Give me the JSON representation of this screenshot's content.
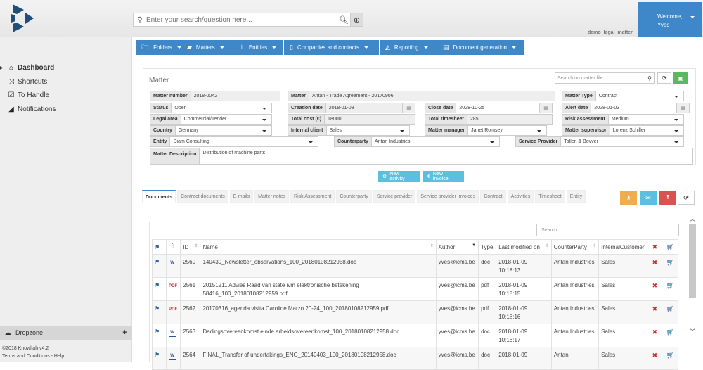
{
  "header": {
    "search_placeholder": "Enter your search/question here...",
    "welcome": "Welcome,",
    "user": "Yves",
    "workspace": "demo_legal_matter"
  },
  "sidebar": {
    "items": [
      {
        "label": "Dashboard",
        "icon": "home-icon",
        "active": true
      },
      {
        "label": "Shortcuts",
        "icon": "shuffle-icon"
      },
      {
        "label": "To Handle",
        "icon": "checkbox-icon"
      },
      {
        "label": "Notifications",
        "icon": "rss-icon"
      }
    ],
    "dropzone": "Dropzone",
    "copyright": "©2018 Knowliah v4.2",
    "terms": "Terms and Conditions - Help"
  },
  "menu": [
    {
      "label": "Folders",
      "icon": "folder-open-icon"
    },
    {
      "label": "Matters",
      "icon": "book-icon"
    },
    {
      "label": "Entities",
      "icon": "sitemap-icon"
    },
    {
      "label": "Companies and contacts",
      "icon": "building-icon"
    },
    {
      "label": "Reporting",
      "icon": "area-chart-icon"
    },
    {
      "label": "Document generation",
      "icon": "file-text-icon"
    }
  ],
  "matter": {
    "title": "Matter",
    "search_placeholder": "Search on matter file",
    "fields": {
      "matter_number": {
        "label": "Matter number",
        "value": "2018-0042"
      },
      "matter": {
        "label": "Matter",
        "value": "Antan - Trade Agreement - 20170906"
      },
      "matter_type": {
        "label": "Matter Type",
        "value": "Contract"
      },
      "status": {
        "label": "Status",
        "value": "Open"
      },
      "creation_date": {
        "label": "Creation date",
        "value": "2018-01-08"
      },
      "close_date": {
        "label": "Close date",
        "value": "2028-10-25"
      },
      "alert_date": {
        "label": "Alert date",
        "value": "2028-01-03"
      },
      "legal_area": {
        "label": "Legal area",
        "value": "Commercial/Tender"
      },
      "total_cost": {
        "label": "Total cost (€)",
        "value": "18000"
      },
      "total_timesheet": {
        "label": "Total timesheet",
        "value": "285"
      },
      "risk_assessment": {
        "label": "Risk assessment",
        "value": "Medium"
      },
      "country": {
        "label": "Country",
        "value": "Germany"
      },
      "internal_client": {
        "label": "Internal client",
        "value": "Sales"
      },
      "matter_manager": {
        "label": "Matter manager",
        "value": "Janet Romsey"
      },
      "matter_supervisor": {
        "label": "Matter supervisor",
        "value": "Lorenz Schiller"
      },
      "entity": {
        "label": "Entity",
        "value": "Diam Consulting"
      },
      "counterparty": {
        "label": "Counterparty",
        "value": "Antan Industries"
      },
      "service_provider": {
        "label": "Service Provider",
        "value": "Tallen & Bovver"
      },
      "description": {
        "label": "Matter Description",
        "value": "Distribution of machine parts"
      }
    }
  },
  "actions": {
    "new_activity": "New activity",
    "new_invoice": "New invoice"
  },
  "tabs": [
    "Documents",
    "Contract documents",
    "E-mails",
    "Matter notes",
    "Risk Assessment",
    "Counterparty",
    "Service provider",
    "Service provider invoices",
    "Contract",
    "Activities",
    "Timesheet",
    "Entity"
  ],
  "documents": {
    "search_placeholder": "Search...",
    "columns": [
      "ID",
      "Name",
      "Author",
      "Type",
      "Last modified on",
      "CounterParty",
      "InternalCustomer"
    ],
    "rows": [
      {
        "id": "2560",
        "name": "140430_Newsletter_observations_100_20180108212958.doc",
        "author": "yves@icms.be",
        "type": "doc",
        "date": "2018-01-09",
        "time": "10:18:13",
        "counterparty": "Antan Industries",
        "internal": "Sales"
      },
      {
        "id": "2561",
        "name": "20151211 Advies Raad van state ivm elektronische betekening 58416_100_20180108212959.pdf",
        "author": "yves@icms.be",
        "type": "pdf",
        "date": "2018-01-09",
        "time": "10:18:15",
        "counterparty": "Antan Industries",
        "internal": "Sales"
      },
      {
        "id": "2562",
        "name": "20170316_agenda visita Caroline Marzo 20-24_100_20180108212959.pdf",
        "author": "yves@icms.be",
        "type": "pdf",
        "date": "2018-01-09",
        "time": "10:18:16",
        "counterparty": "Antan Industries",
        "internal": "Sales"
      },
      {
        "id": "2563",
        "name": "Dadingsovereenkomst einde arbeidsovereenkomst_100_20180108212958.doc",
        "author": "yves@icms.be",
        "type": "doc",
        "date": "2018-01-09",
        "time": "10:18:17",
        "counterparty": "Antan Industries",
        "internal": "Sales"
      },
      {
        "id": "2564",
        "name": "FINAL_Transfer of undertakings_ENG_20140403_100_20180108212958.doc",
        "author": "yves@icms.be",
        "type": "doc",
        "date": "2018-01-09",
        "time": "",
        "counterparty": "Antan",
        "internal": "Sales"
      }
    ]
  },
  "colors": {
    "primary": "#3e87c8",
    "info": "#5bc0de",
    "success": "#5cb85c",
    "warning": "#f0ad4e",
    "danger": "#d9534f"
  }
}
